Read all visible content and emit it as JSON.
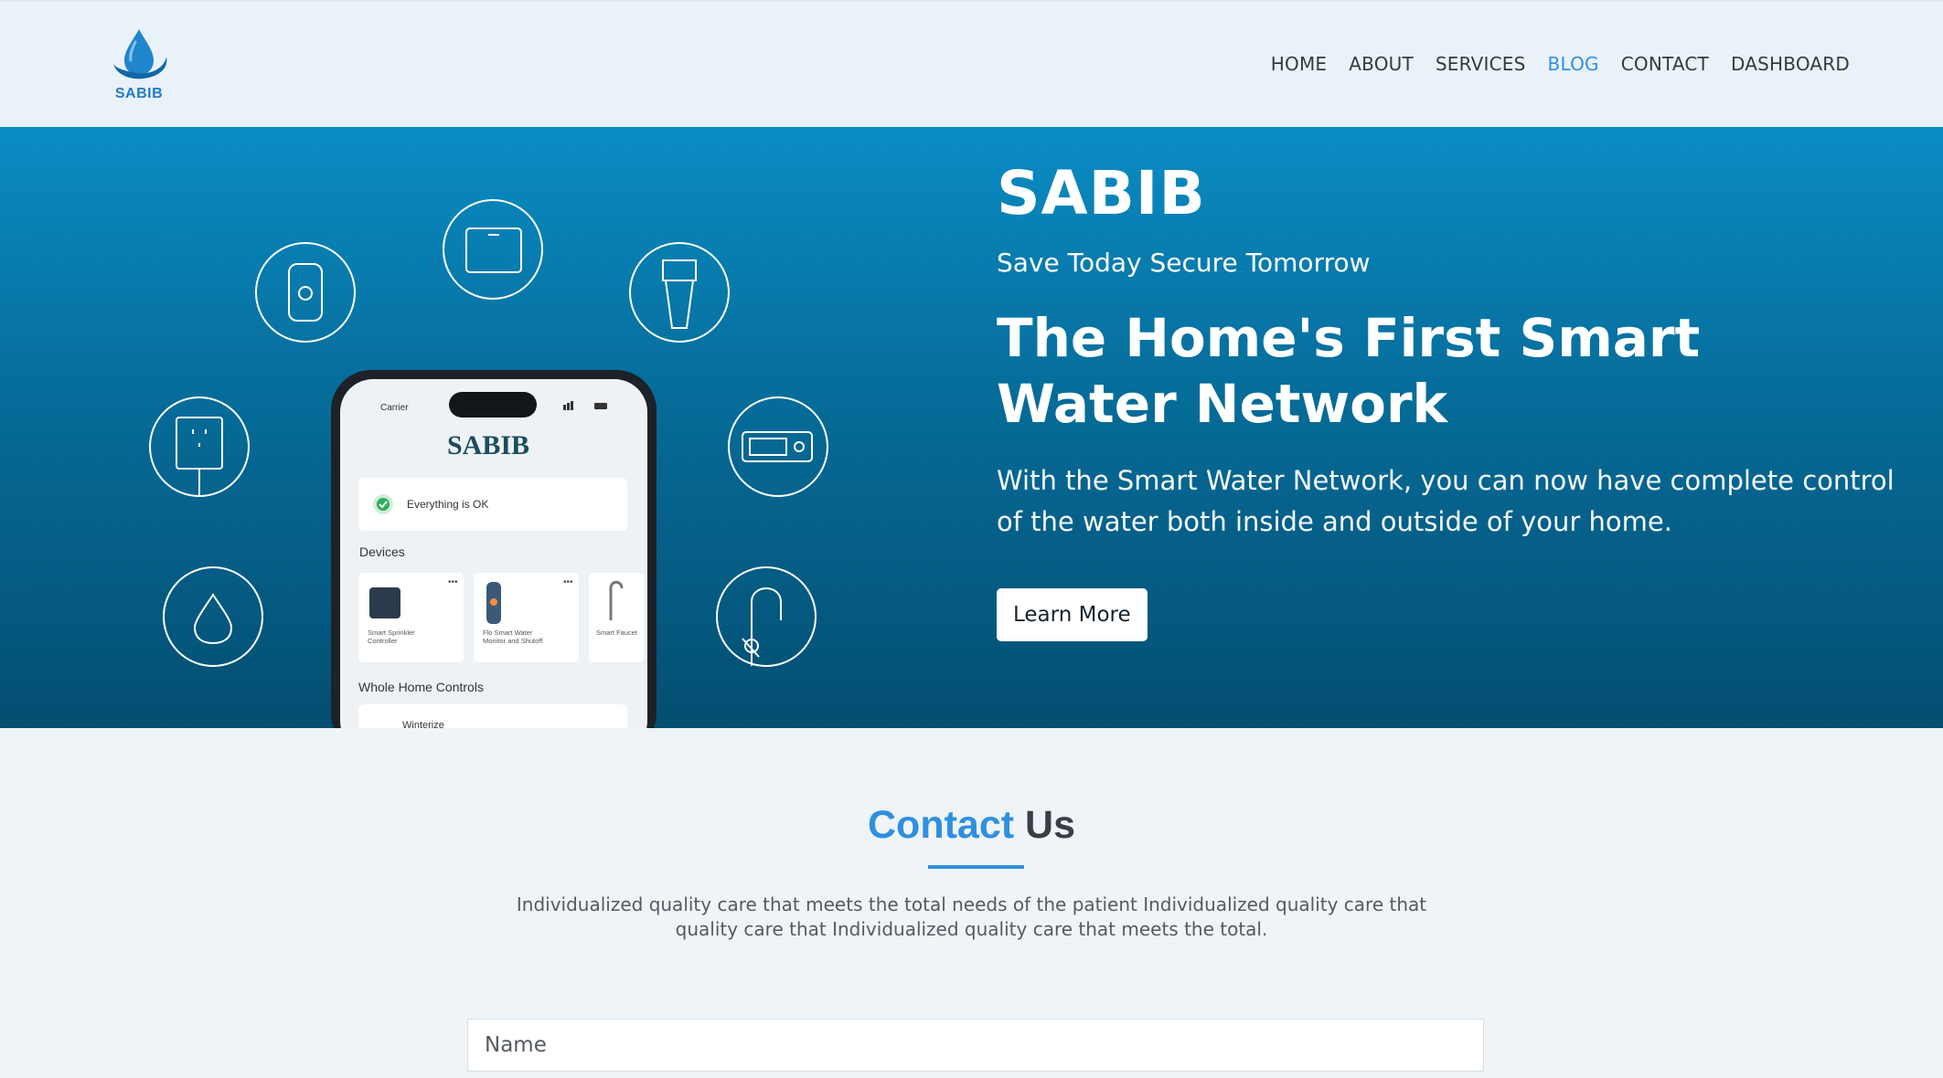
{
  "brand": {
    "logo_text": "SABIB",
    "primary_color": "#2f8fe0"
  },
  "nav": {
    "items": [
      {
        "label": "HOME",
        "active": false
      },
      {
        "label": "ABOUT",
        "active": false
      },
      {
        "label": "SERVICES",
        "active": false
      },
      {
        "label": "BLOG",
        "active": true
      },
      {
        "label": "CONTACT",
        "active": false
      },
      {
        "label": "DASHBOARD",
        "active": false
      }
    ]
  },
  "hero": {
    "brand": "SABIB",
    "tagline": "Save Today Secure Tomorrow",
    "headline": "The Home's First Smart Water Network",
    "description": "With the Smart Water Network, you can now have complete control of the water both inside and outside of your home.",
    "cta_label": "Learn More",
    "phone": {
      "carrier": "Carrier",
      "app_title": "SABIB",
      "status": "Everything is OK",
      "devices_label": "Devices",
      "devices": [
        {
          "name_line1": "Smart Sprinkler",
          "name_line2": "Controller"
        },
        {
          "name_line1": "Flo Smart Water",
          "name_line2": "Monitor and Shutoff"
        },
        {
          "name_line1": "Smart Faucet",
          "name_line2": ""
        }
      ],
      "controls_label": "Whole Home Controls",
      "control_item": "Winterize"
    },
    "device_icons": [
      "sensor-icon",
      "panel-icon",
      "shower-head-icon",
      "outlet-icon",
      "meter-icon",
      "water-drop-icon",
      "faucet-icon"
    ]
  },
  "contact": {
    "title_highlight": "Contact",
    "title_rest": "Us",
    "description": "Individualized quality care that meets the total needs of the patient Individualized quality care that quality care that Individualized quality care that meets the total.",
    "name_placeholder": "Name"
  }
}
